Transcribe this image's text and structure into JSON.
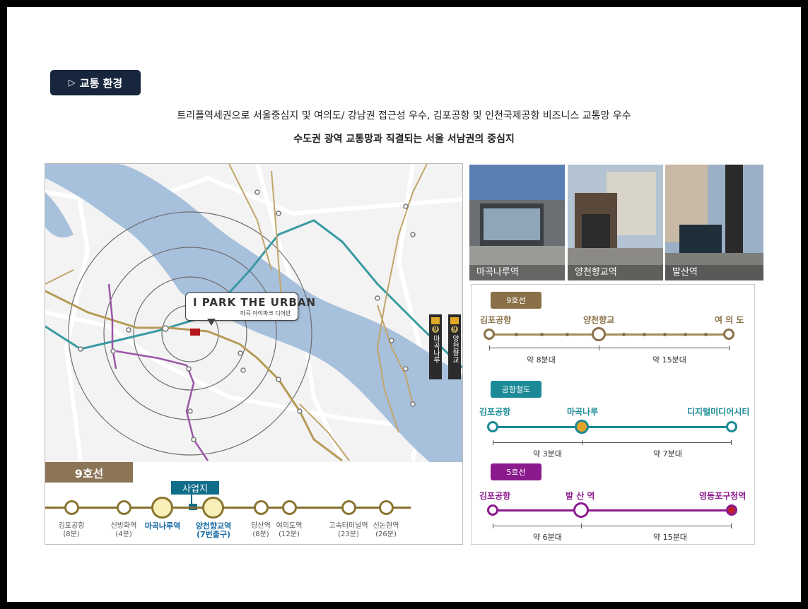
{
  "header": {
    "section_title": "교통 환경",
    "line1": "트리플역세권으로 서울중심지 및 여의도/ 강남권 접근성 우수, 김포공항 및 인천국제공항 비즈니스 교통망 우수",
    "line2": "수도권 광역 교통망과 직결되는 서울 서남권의 중심지"
  },
  "map": {
    "logo_main": "I PARK THE URBAN",
    "logo_sub": "마곡 아이파크 디어반",
    "line_tag": "9호선",
    "site_label": "사업지",
    "stations": [
      {
        "name": "김포공항",
        "time": "(8분)"
      },
      {
        "name": "신방화역",
        "time": "(4분)"
      },
      {
        "name": "마곡나루역",
        "time": ""
      },
      {
        "name": "양천향교역",
        "time": "(7번출구)"
      },
      {
        "name": "당산역",
        "time": "(8분)"
      },
      {
        "name": "여의도역",
        "time": "(12분)"
      },
      {
        "name": "고속터미널역",
        "time": "(23분)"
      },
      {
        "name": "신논현역",
        "time": "(26분)"
      }
    ],
    "signs": [
      "마곡나루",
      "양천향교"
    ],
    "sign_number": "9"
  },
  "photos": [
    {
      "caption": "마곡나루역"
    },
    {
      "caption": "양천향교역"
    },
    {
      "caption": "발산역"
    }
  ],
  "routes": [
    {
      "tag": "9호선",
      "color": "#8a7048",
      "from": "김포공항",
      "mid": "양천향교",
      "to": "여 의 도",
      "d1": "약  8분대",
      "d2": "약  15분대"
    },
    {
      "tag": "공항철도",
      "color": "#1b8a96",
      "from": "김포공항",
      "mid": "마곡나루",
      "to": "디지털미디어시티",
      "d1": "약  3분대",
      "d2": "약  7분대"
    },
    {
      "tag": "5호선",
      "color": "#8b1a8e",
      "from": "김포공항",
      "mid": "발 산 역",
      "to": "영등포구청역",
      "d1": "약  6분대",
      "d2": "약  15분대"
    }
  ]
}
